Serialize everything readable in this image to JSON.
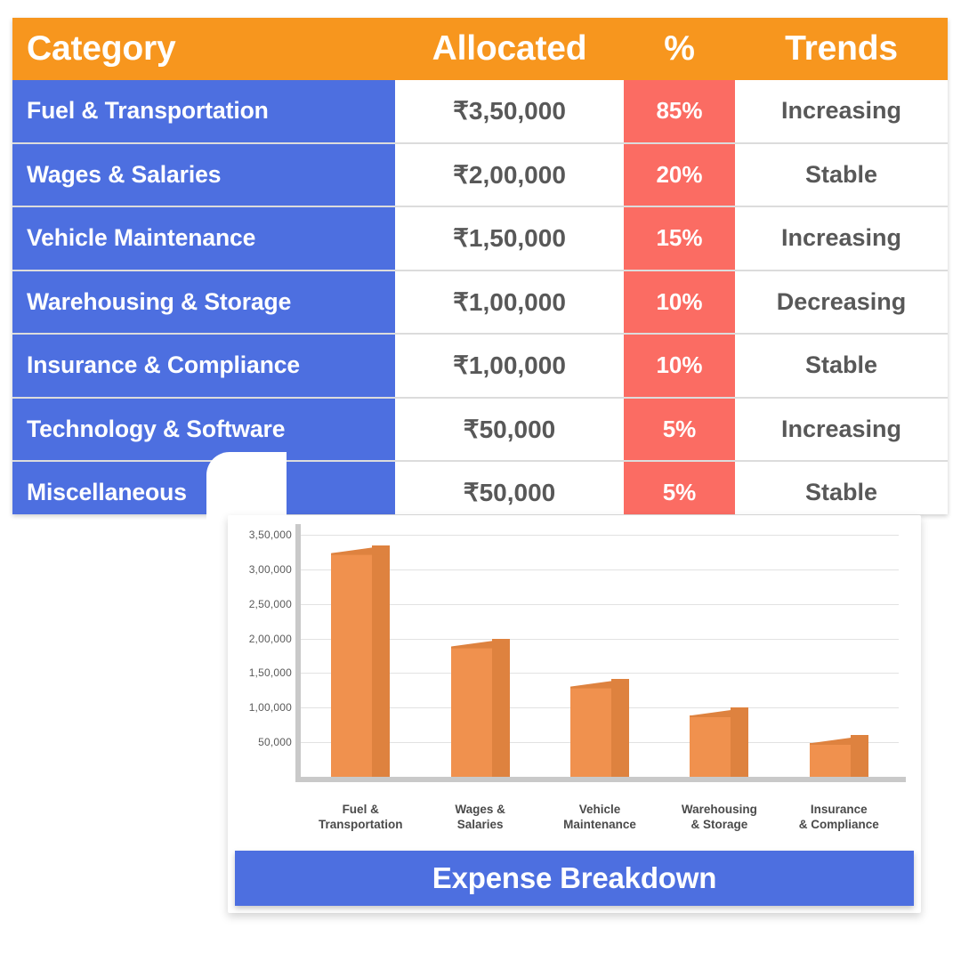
{
  "theme": {
    "header_orange": "#F7961E",
    "category_blue": "#4D6FE0",
    "percent_coral": "#FB6C63",
    "bar_front": "#F0914E",
    "bar_side": "#DE823F",
    "text_gray": "#585858",
    "grid_gray": "#E2E2E2"
  },
  "table": {
    "columns": [
      "Category",
      "Allocated",
      "%",
      "Trends"
    ],
    "rows": [
      {
        "category": "Fuel & Transportation",
        "allocated": "₹3,50,000",
        "percent": "85%",
        "trend": "Increasing"
      },
      {
        "category": "Wages & Salaries",
        "allocated": "₹2,00,000",
        "percent": "20%",
        "trend": "Stable"
      },
      {
        "category": "Vehicle Maintenance",
        "allocated": "₹1,50,000",
        "percent": "15%",
        "trend": "Increasing"
      },
      {
        "category": "Warehousing & Storage",
        "allocated": "₹1,00,000",
        "percent": "10%",
        "trend": "Decreasing"
      },
      {
        "category": "Insurance & Compliance",
        "allocated": "₹1,00,000",
        "percent": "10%",
        "trend": "Stable"
      },
      {
        "category": "Technology & Software",
        "allocated": "₹50,000",
        "percent": "5%",
        "trend": "Increasing"
      },
      {
        "category": "Miscellaneous",
        "allocated": "₹50,000",
        "percent": "5%",
        "trend": "Stable"
      }
    ]
  },
  "chart_data": {
    "type": "bar",
    "title": "Expense Breakdown",
    "xlabel": "",
    "ylabel": "",
    "categories": [
      "Fuel &\nTransportation",
      "Wages &\nSalaries",
      "Vehicle\nMaintenance",
      "Warehousing\n& Storage",
      "Insurance\n& Compliance"
    ],
    "values": [
      335000,
      200000,
      142000,
      100000,
      60000
    ],
    "ylim": [
      0,
      350000
    ],
    "yticks": [
      50000,
      100000,
      150000,
      200000,
      250000,
      300000,
      350000
    ],
    "ytick_labels": [
      "50,000",
      "1,00,000",
      "1,50,000",
      "2,00,000",
      "2,50,000",
      "3,00,000",
      "3,50,000"
    ],
    "grid": true,
    "legend": false,
    "style": "3d-bar"
  }
}
